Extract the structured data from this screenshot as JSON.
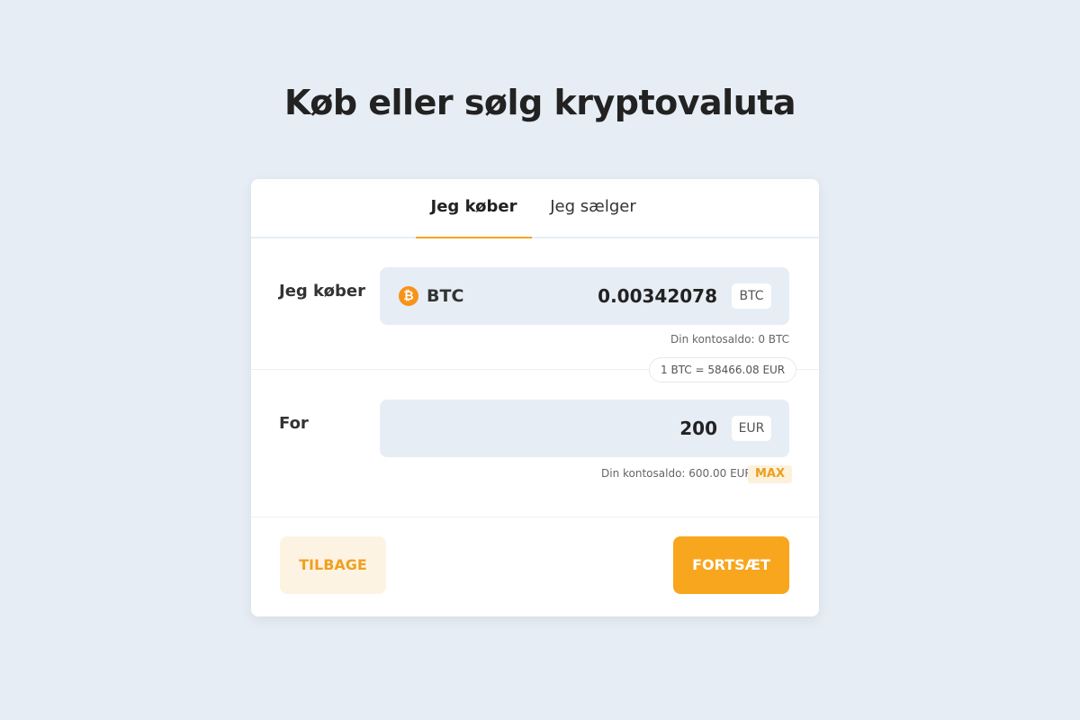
{
  "page": {
    "title": "Køb eller sølg kryptovaluta"
  },
  "tabs": [
    {
      "label": "Jeg køber",
      "active": true
    },
    {
      "label": "Jeg sælger",
      "active": false
    }
  ],
  "buy_row": {
    "label": "Jeg køber",
    "coin_icon": "bitcoin-icon",
    "coin_symbol_glyph": "₿",
    "coin_name": "BTC",
    "amount": "0.00342078",
    "unit": "BTC",
    "balance": "Din kontosaldo: 0 BTC"
  },
  "rate": "1 BTC = 58466.08 EUR",
  "pay_row": {
    "label": "For",
    "amount": "200",
    "unit": "EUR",
    "balance": "Din kontosaldo: 600.00 EUR",
    "max_label": "MAX"
  },
  "actions": {
    "back_label": "TILBAGE",
    "continue_label": "FORTSÆT"
  },
  "colors": {
    "background": "#e7edf4",
    "accent": "#f8a61e",
    "bitcoin": "#f7931a"
  }
}
